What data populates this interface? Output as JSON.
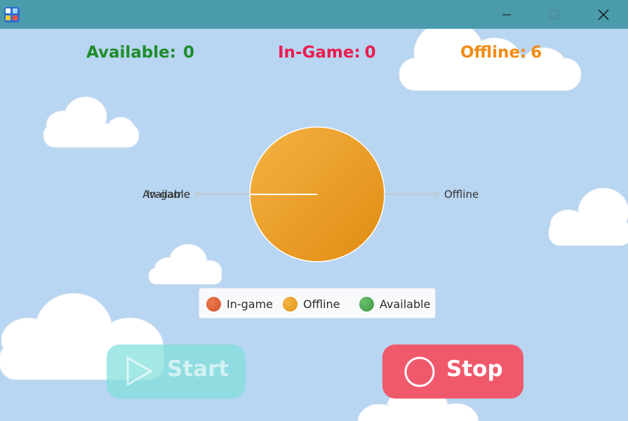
{
  "stats": {
    "available_label": "Available:",
    "available_value": "0",
    "ingame_label": "In-Game:",
    "ingame_value": "0",
    "offline_label": "Offline:",
    "offline_value": "6"
  },
  "chart_data": {
    "type": "pie",
    "categories": [
      "In-game",
      "Offline",
      "Available"
    ],
    "values": [
      0,
      6,
      0
    ],
    "slice_labels": [
      "In-game",
      "Offline",
      "Available"
    ],
    "colors": [
      "#e2643a",
      "#eea02c",
      "#4aa84a"
    ],
    "legend": [
      "In-game",
      "Offline",
      "Available"
    ],
    "legend_placement": "bottom"
  },
  "buttons": {
    "start_label": "Start",
    "stop_label": "Stop"
  },
  "colors": {
    "available": "#1e8c2b",
    "ingame": "#ec1c4f",
    "offline": "#f38b14",
    "titlebar": "#4a9bab",
    "background": "#b8d5f1"
  },
  "icons": [
    "app-icon",
    "minimize-icon",
    "maximize-icon",
    "close-icon",
    "play-icon",
    "stop-circle-icon"
  ]
}
